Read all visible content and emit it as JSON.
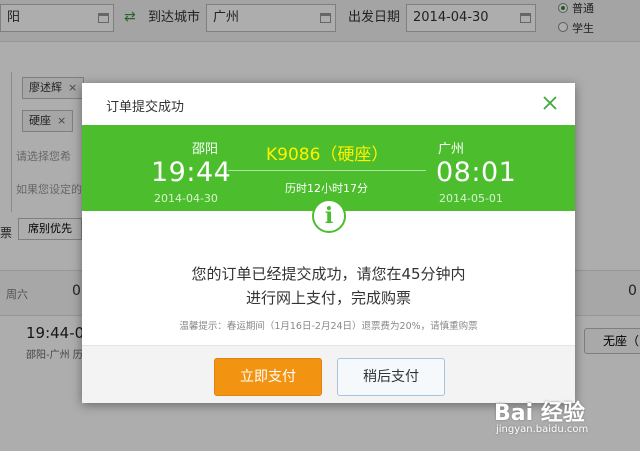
{
  "background": {
    "from_value": "阳",
    "swap_icon": "swap-arrows-icon",
    "to_label": "到达城市",
    "to_value": "广州",
    "date_label": "出发日期",
    "date_value": "2014-04-30",
    "ticket_types": [
      "普通",
      "学生"
    ],
    "passenger_chip": "廖述辉",
    "seat_chip": "硬座",
    "chip_close": "×",
    "hint1": "请选择您希",
    "hint2": "如果您设定的",
    "seat_pref_label": "票",
    "seat_pref_button": "席别优先",
    "day_label": "周六",
    "day_value": "0",
    "day_value2": "0",
    "train_time": "19:44-0",
    "train_route": "邵阳-广州 历",
    "no_seat_button": "无座（"
  },
  "modal": {
    "title": "订单提交成功",
    "close_icon": "close-icon",
    "from_station": "邵阳",
    "depart_time": "19:44",
    "depart_date": "2014-04-30",
    "train": "K9086（硬座）",
    "duration": "历时12小时17分",
    "to_station": "广州",
    "arrive_time": "08:01",
    "arrive_date": "2014-05-01",
    "info_icon": "i",
    "message_line1": "您的订单已经提交成功，请您在45分钟内",
    "message_line2": "进行网上支付，完成购票",
    "tip": "温馨提示：春运期间（1月16日-2月24日）退票费为20%，请慎重购票",
    "pay_now": "立即支付",
    "pay_later": "稍后支付"
  },
  "watermark": {
    "brand": "Bai 经验",
    "url": "jingyan.baidu.com"
  },
  "colors": {
    "accent_green": "#4cbe2d",
    "train_yellow": "#fff200",
    "pay_orange": "#f29411"
  }
}
